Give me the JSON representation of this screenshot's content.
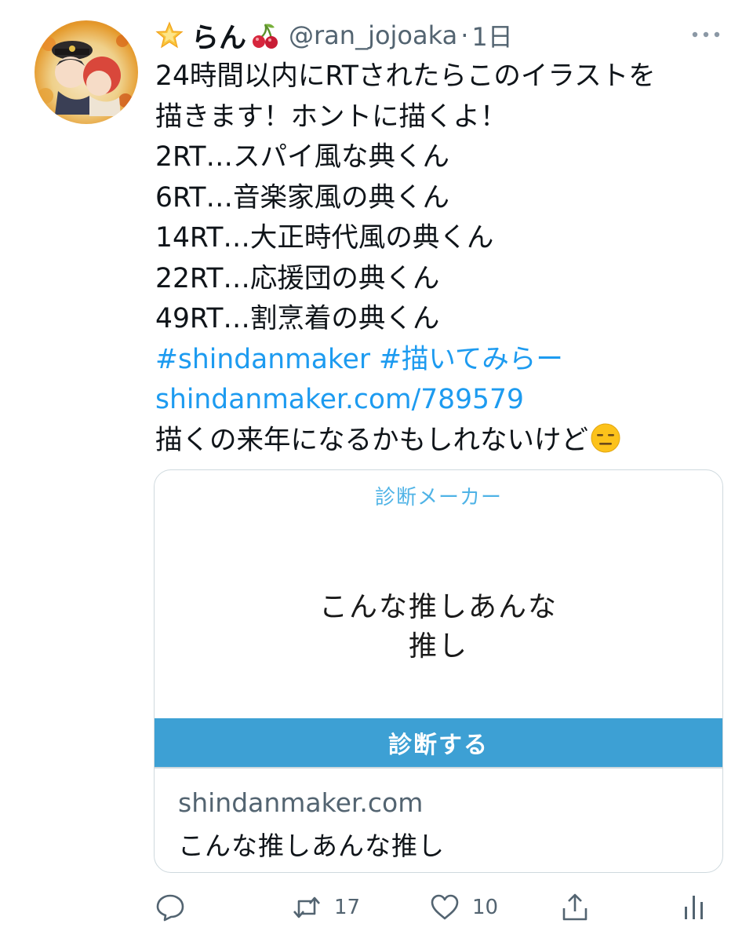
{
  "author": {
    "name": "らん",
    "handle": "@ran_jojoaka",
    "separator": "·",
    "time": "1日"
  },
  "tweet": {
    "lines": [
      "24時間以内にRTされたらこのイラストを",
      "描きます！ホントに描くよ！",
      "2RT…スパイ風な典くん",
      "6RT…音楽家風の典くん",
      "14RT…大正時代風の典くん",
      "22RT…応援団の典くん",
      "49RT…割烹着の典くん"
    ],
    "hashtag_1": "#shindanmaker",
    "hashtag_2": "#描いてみらー",
    "url": "shindanmaker.com/789579",
    "closing": "描くの来年になるかもしれないけど"
  },
  "card": {
    "site_label": "診断メーカー",
    "title_line_1": "こんな推しあんな",
    "title_line_2": "推し",
    "cta": "診断する",
    "domain": "shindanmaker.com",
    "description": "こんな推しあんな推し"
  },
  "actions": {
    "reply_count": "",
    "retweet_count": "17",
    "like_count": "10"
  },
  "colors": {
    "link": "#1d9bf0",
    "cta_bg": "#3da0d4",
    "secondary_text": "#536471"
  },
  "icons": [
    "glowing-star-icon",
    "cherries-icon",
    "more-icon",
    "expressionless-face-icon",
    "reply-icon",
    "retweet-icon",
    "like-icon",
    "share-icon",
    "analytics-icon"
  ]
}
